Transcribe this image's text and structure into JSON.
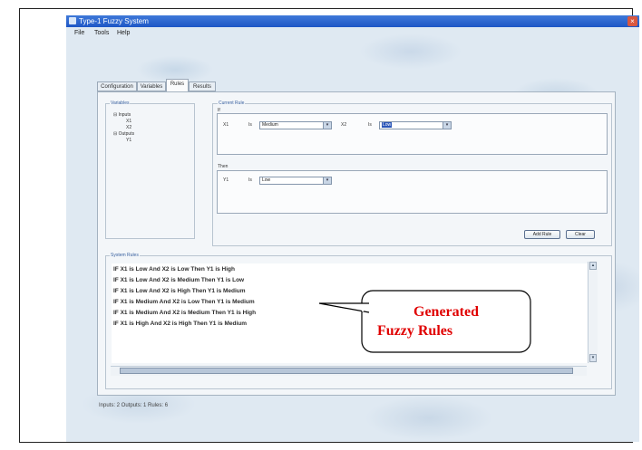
{
  "window": {
    "title": "Type-1 Fuzzy System",
    "close_label": "×"
  },
  "menu": [
    "File",
    "Tools",
    "Help"
  ],
  "tabs": [
    "Configuration",
    "Variables",
    "Rules",
    "Results"
  ],
  "active_tab": "Rules",
  "variables_group": {
    "label": "Variables",
    "tree": {
      "inputs": {
        "label": "Inputs",
        "children": [
          "X1",
          "X2"
        ]
      },
      "outputs": {
        "label": "Outputs",
        "children": [
          "Y1"
        ]
      }
    }
  },
  "current_rule": {
    "label": "Current Rule",
    "if_label": "If",
    "then_label": "Then",
    "if_clause_1": {
      "var": "X1",
      "is": "Is",
      "value": "Medium"
    },
    "if_clause_2": {
      "var": "X2",
      "is": "Is",
      "value": "Low"
    },
    "then_clause": {
      "var": "Y1",
      "is": "Is",
      "value": "Low"
    }
  },
  "buttons": {
    "add_rule": "Add Rule",
    "clear": "Clear"
  },
  "system_rules": {
    "label": "System Rules",
    "rules": [
      "IF X1 is Low And X2 is Low Then Y1 is High",
      "IF X1 is Low And X2 is Medium Then Y1 is Low",
      "IF X1 is Low And X2 is High Then Y1 is Medium",
      "IF X1 is Medium And X2 is Low Then Y1 is Medium",
      "IF X1 is Medium And X2 is Medium Then Y1 is High",
      "IF X1 is High And X2 is High Then Y1 is Medium"
    ]
  },
  "status": "Inputs: 2  Outputs: 1  Rules: 6",
  "callout": {
    "line1": "Generated",
    "line2": "Fuzzy Rules",
    "color": "#e00000"
  }
}
